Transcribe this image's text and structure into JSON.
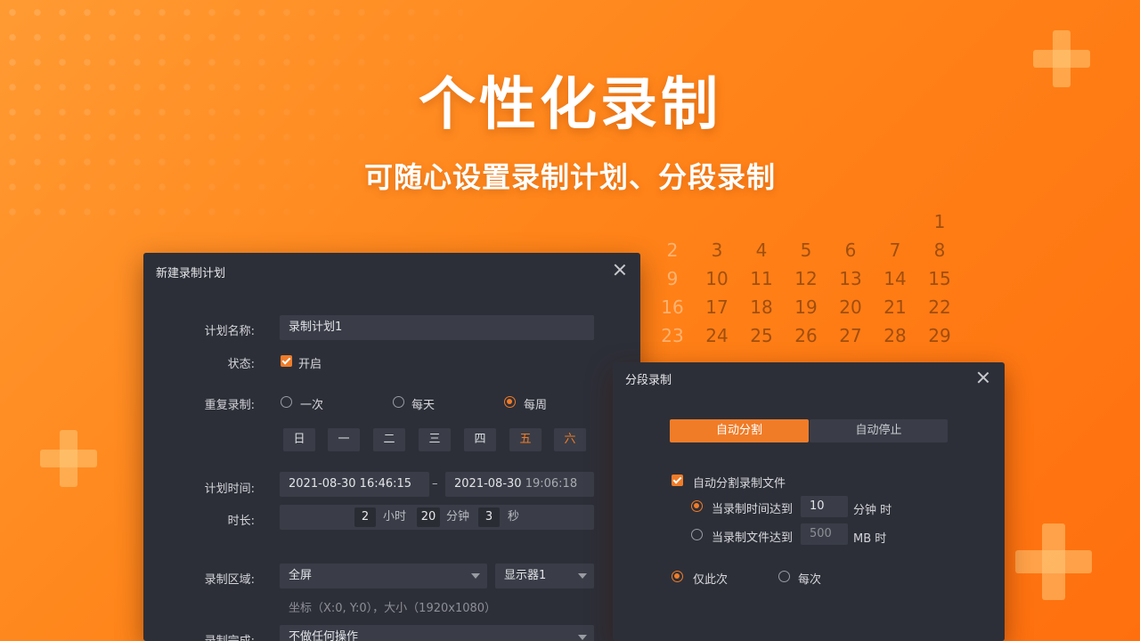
{
  "banner": {
    "headline": "个性化录制",
    "subline": "可随心设置录制计划、分段录制"
  },
  "calendar": {
    "rows": [
      [
        "",
        "",
        "",
        "",
        "",
        "",
        "1"
      ],
      [
        "2",
        "3",
        "4",
        "5",
        "6",
        "7",
        "8"
      ],
      [
        "9",
        "10",
        "11",
        "12",
        "13",
        "14",
        "15"
      ],
      [
        "16",
        "17",
        "18",
        "19",
        "20",
        "21",
        "22"
      ],
      [
        "23",
        "24",
        "25",
        "26",
        "27",
        "28",
        "29"
      ]
    ]
  },
  "plan_dialog": {
    "title": "新建录制计划",
    "name_label": "计划名称:",
    "name_value": "录制计划1",
    "status_label": "状态:",
    "status_option": "开启",
    "repeat_label": "重复录制:",
    "repeat_options": [
      "一次",
      "每天",
      "每周"
    ],
    "repeat_selected": "每周",
    "weekdays": [
      "日",
      "一",
      "二",
      "三",
      "四",
      "五",
      "六"
    ],
    "time_label": "计划时间:",
    "start_time": "2021-08-30 16:46:15",
    "range_sep": "–",
    "end_date": "2021-08-30",
    "end_time": "19:06:18",
    "duration_label": "时长:",
    "hours": "2",
    "hours_unit": "小时",
    "minutes": "20",
    "minutes_unit": "分钟",
    "seconds": "3",
    "seconds_unit": "秒",
    "area_label": "录制区域:",
    "area_value": "全屏",
    "monitor_value": "显示器1",
    "coords_text": "坐标（X:0, Y:0），大小（1920x1080）",
    "finish_label": "录制完成:",
    "finish_value": "不做任何操作"
  },
  "segment_dialog": {
    "title": "分段录制",
    "tabs": [
      "自动分割",
      "自动停止"
    ],
    "active_tab": "自动分割",
    "auto_split_label": "自动分割录制文件",
    "by_time_label": "当录制时间达到",
    "by_time_value": "10",
    "by_time_unit": "分钟 时",
    "by_size_label": "当录制文件达到",
    "by_size_value": "500",
    "by_size_unit": "MB 时",
    "scope_options": [
      "仅此次",
      "每次"
    ],
    "scope_selected": "仅此次"
  },
  "colors": {
    "accent": "#f07c28",
    "dialog_bg": "#2d2f38",
    "field_bg": "#3a3d47",
    "banner_orange": "#ff8419"
  }
}
